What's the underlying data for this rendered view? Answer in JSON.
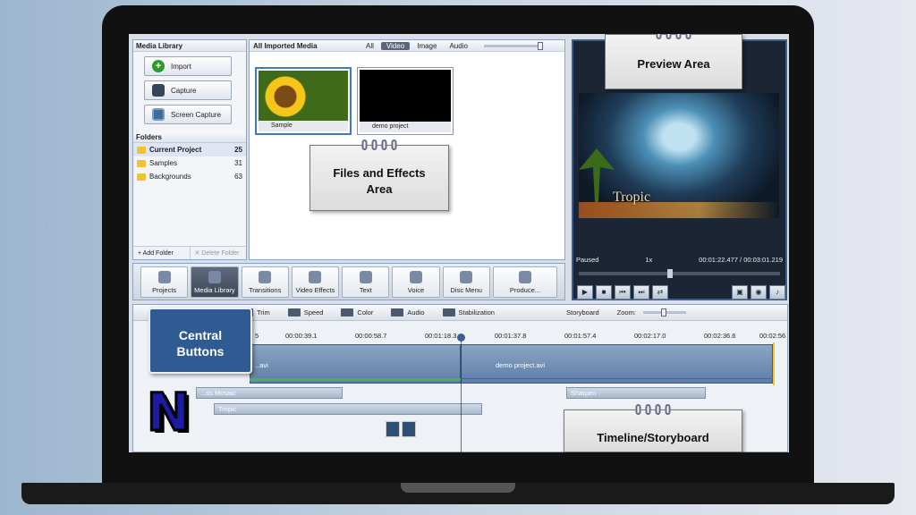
{
  "media_library": {
    "title": "Media Library",
    "buttons": [
      "Import",
      "Capture",
      "Screen Capture"
    ],
    "folders_title": "Folders",
    "folders": [
      {
        "name": "Current Project",
        "count": "25"
      },
      {
        "name": "Samples",
        "count": "31"
      },
      {
        "name": "Backgrounds",
        "count": "63"
      }
    ],
    "add_folder": "+ Add Folder",
    "delete_folder": "✕ Delete Folder"
  },
  "files": {
    "title": "All Imported Media",
    "filters": [
      "All",
      "Video",
      "Image",
      "Audio"
    ],
    "active_filter": "Video",
    "items": [
      {
        "label": "Sample"
      },
      {
        "label": "demo project"
      }
    ]
  },
  "central_buttons": [
    "Projects",
    "Media Library",
    "Transitions",
    "Video Effects",
    "Text",
    "Voice",
    "Disc Menu",
    "Produce..."
  ],
  "preview": {
    "overlay_text": "Tropic",
    "status": "Paused",
    "speed": "1x",
    "time": "00:01:22.477 / 00:03:01.219",
    "seek_progress": 0.45
  },
  "timeline": {
    "tools": [
      "Trim",
      "Speed",
      "Color",
      "Audio",
      "Stabilization"
    ],
    "storyboard": "Storyboard",
    "zoom_label": "Zoom:",
    "ruler": [
      "5",
      "00:00:39.1",
      "00:00:58.7",
      "00:01:18.3",
      "00:01:37.8",
      "00:01:57.4",
      "00:02:17.0",
      "00:02:36.6",
      "00:02:56"
    ],
    "clips": {
      "video_left": "...avi",
      "video_right": "demo project.avi",
      "effect1": "...ss Mosaic",
      "effect2": "Sharpen",
      "text": "Tropic"
    }
  },
  "callouts": {
    "preview": "Preview Area",
    "files": "Files and Effects Area",
    "central": "Central Buttons",
    "timeline": "Timeline/Storyboard"
  },
  "logo": "N",
  "colors": {
    "accent": "#2e5b91",
    "laptop": "#111111",
    "logo": "#1d1aa3"
  }
}
